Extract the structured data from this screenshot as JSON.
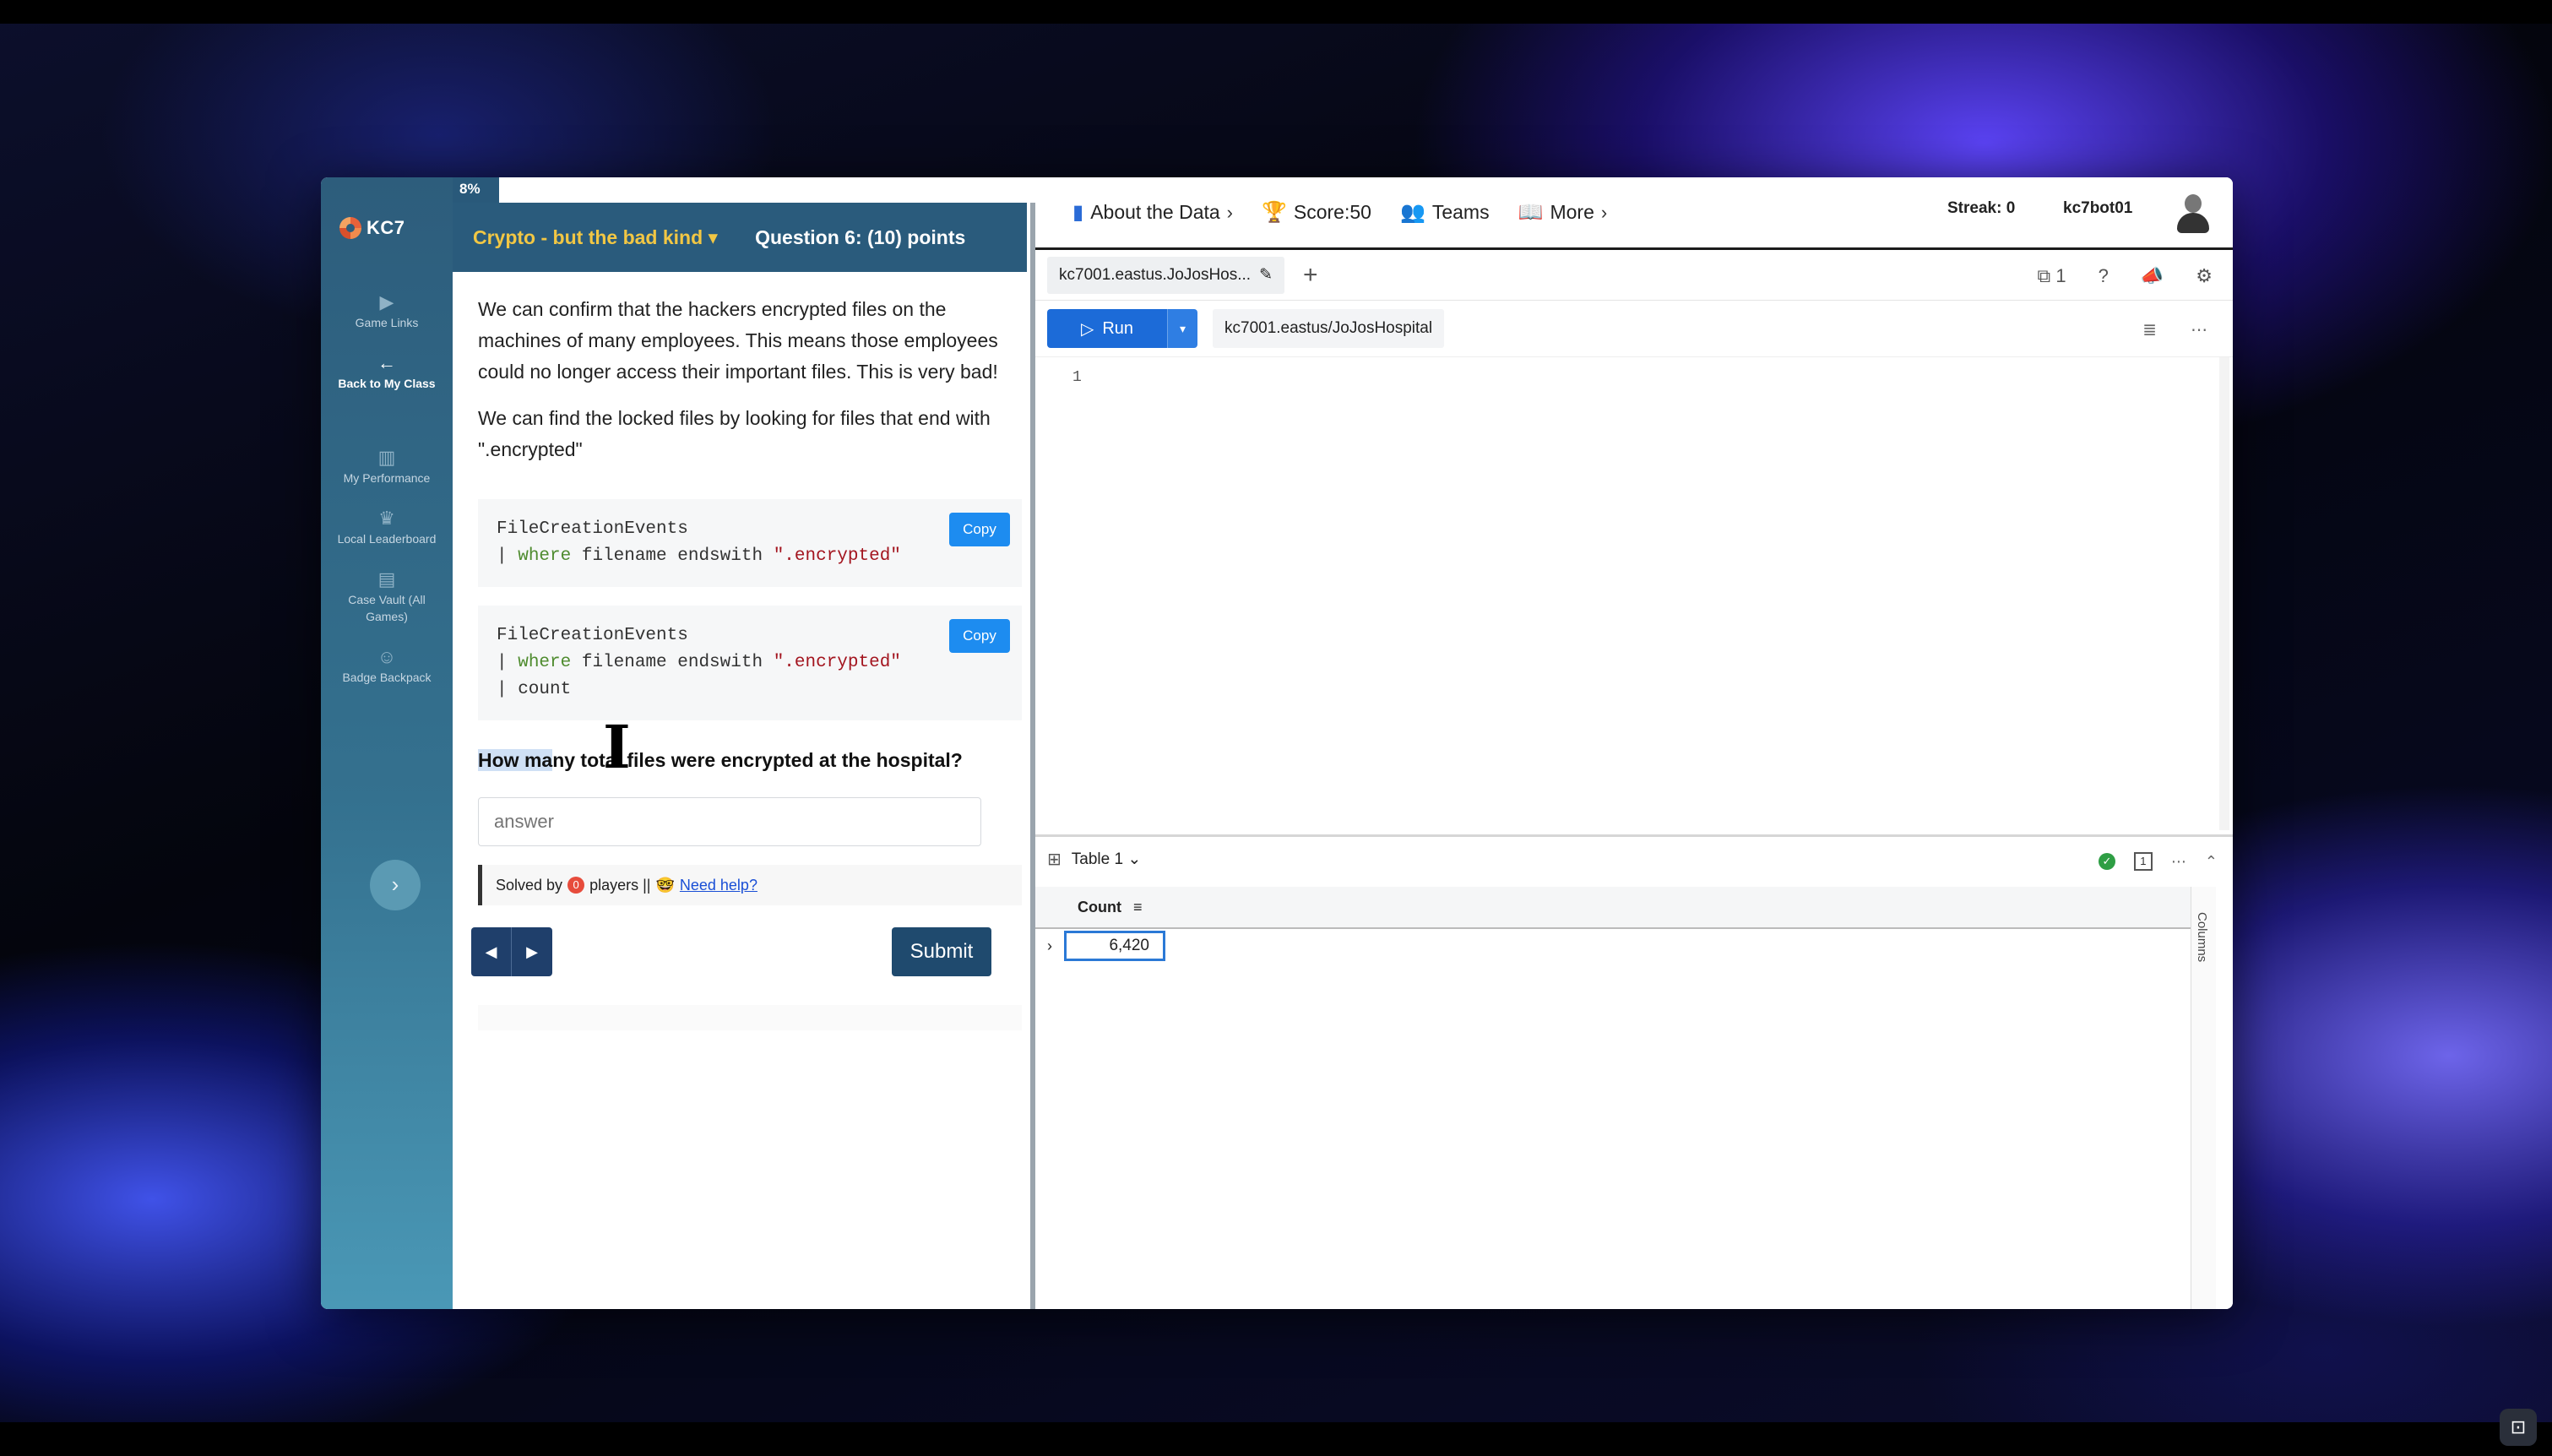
{
  "sidebar": {
    "logo": "KC7",
    "items": [
      {
        "label": "Game Links",
        "icon": "play-icon",
        "active": false
      },
      {
        "label": "Back to My Class",
        "icon": "arrow-left-icon",
        "active": true
      },
      {
        "label": "My Performance",
        "icon": "chart-icon",
        "active": false
      },
      {
        "label": "Local Leaderboard",
        "icon": "trophy-icon",
        "active": false
      },
      {
        "label": "Case Vault (All Games)",
        "icon": "archive-icon",
        "active": false
      },
      {
        "label": "Badge Backpack",
        "icon": "person-icon",
        "active": false
      }
    ]
  },
  "question": {
    "progress": "8%",
    "progress_value": 0.08,
    "category": "Crypto - but the bad kind",
    "title": "Question 6:  (10) points",
    "paragraph1": "We can confirm that the hackers encrypted files on the machines of many employees. This means those employees could no longer access their important files. This is very bad!",
    "paragraph2": "We can find the locked files by looking for files that end with \".encrypted\"",
    "code1": {
      "line1": "FileCreationEvents",
      "line2_pipe": "| ",
      "line2_kw": "where",
      "line2_mid": " filename endswith ",
      "line2_str": "\".encrypted\""
    },
    "code2": {
      "line1": "FileCreationEvents",
      "line2_pipe": "| ",
      "line2_kw": "where",
      "line2_mid": " filename endswith ",
      "line2_str": "\".encrypted\"",
      "line3": "| count"
    },
    "copy_label": "Copy",
    "prompt_highlight": "How ma",
    "prompt_rest": "ny total files were encrypted at the hospital?",
    "answer_placeholder": "answer",
    "solved_prefix": "Solved by",
    "solved_count": "0",
    "solved_suffix": "players ||",
    "help_emoji": "🤓",
    "help_link": "Need help?",
    "prev_label": "◀",
    "next_label": "▶",
    "submit_label": "Submit"
  },
  "topbar": {
    "about": "About the Data",
    "score": "Score:50",
    "teams": "Teams",
    "more": "More",
    "streak": "Streak: 0",
    "user": "kc7bot01"
  },
  "editor": {
    "tab_label": "kc7001.eastus.JoJosHos...",
    "copies_count": "1",
    "run_label": "Run",
    "connection": "kc7001.eastus/JoJosHospital",
    "line_number": "1"
  },
  "results": {
    "table_label": "Table 1",
    "status_count": "1",
    "column": "Count",
    "value": "6,420",
    "columns_rail": "Columns"
  },
  "colors": {
    "sidebar": "#2d5d7c",
    "header": "#2a5b7c",
    "category": "#f2c744",
    "run": "#1c6bd8",
    "copy": "#1d8cf0"
  }
}
